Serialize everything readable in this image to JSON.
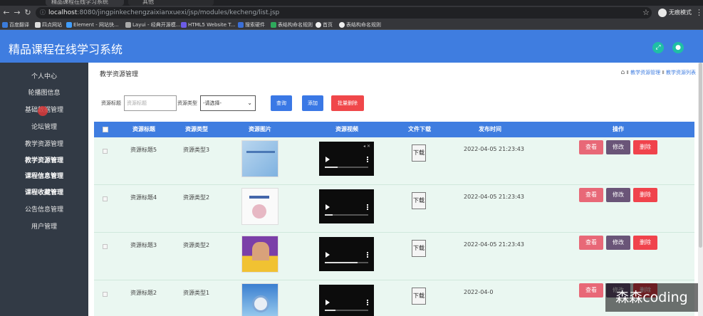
{
  "browser": {
    "tabs": [
      {
        "title": "精品课程在线学习系统",
        "active": true
      },
      {
        "title": "其他",
        "active": false
      }
    ],
    "url_host": "localhost",
    "url_path": ":8080/jingpinkechengzaixianxuexi/jsp/modules/kecheng/list.jsp",
    "profile": "无痕模式",
    "bookmarks": [
      "百度翻译",
      "四点网站",
      "Element - 网站快...",
      "Layui - 经典开源模...",
      "HTML5 Website T...",
      "搜索硬件",
      "表结构命名规则",
      "首页",
      "表结构命名规则"
    ]
  },
  "app": {
    "title": "精品课程在线学习系统",
    "colors": {
      "primary": "#3f7de0",
      "sidebar": "#323a45",
      "row_bg": "#eaf7f1"
    }
  },
  "sidebar": {
    "items": [
      {
        "label": "个人中心"
      },
      {
        "label": "轮播图信息"
      },
      {
        "label": "基础数据管理"
      },
      {
        "label": "论坛管理"
      },
      {
        "label": "教学资源管理"
      },
      {
        "label": "教学资源管理"
      },
      {
        "label": "课程信息管理"
      },
      {
        "label": "课程收藏管理"
      },
      {
        "label": "公告信息管理"
      },
      {
        "label": "用户管理"
      }
    ]
  },
  "page": {
    "title": "教学资源管理",
    "breadcrumb": [
      "教学资源管理",
      "教学资源列表"
    ]
  },
  "search": {
    "title_label": "资源标题",
    "title_placeholder": "资源标题",
    "type_label": "资源类型",
    "type_selected": "-请选择-",
    "query_button": "查询",
    "add_button": "添加",
    "batch_delete_button": "批量删除"
  },
  "table": {
    "columns": [
      "资源标题",
      "资源类型",
      "资源图片",
      "资源视频",
      "文件下载",
      "发布时间",
      "操作"
    ],
    "download_label": "下载",
    "actions": {
      "view": "查看",
      "edit": "修改",
      "delete": "删除"
    },
    "rows": [
      {
        "title": "资源标题5",
        "type": "资源类型3",
        "time": "2022-04-05 21:23:43",
        "image": "cover-blue"
      },
      {
        "title": "资源标题4",
        "type": "资源类型2",
        "time": "2022-04-05 21:23:43",
        "image": "cover-math"
      },
      {
        "title": "资源标题3",
        "type": "资源类型2",
        "time": "2022-04-05 21:23:43",
        "image": "cover-ielts"
      },
      {
        "title": "资源标题2",
        "type": "资源类型1",
        "time": "2022-04-0",
        "image": "cover-cd"
      }
    ]
  },
  "watermark": "森森coding"
}
